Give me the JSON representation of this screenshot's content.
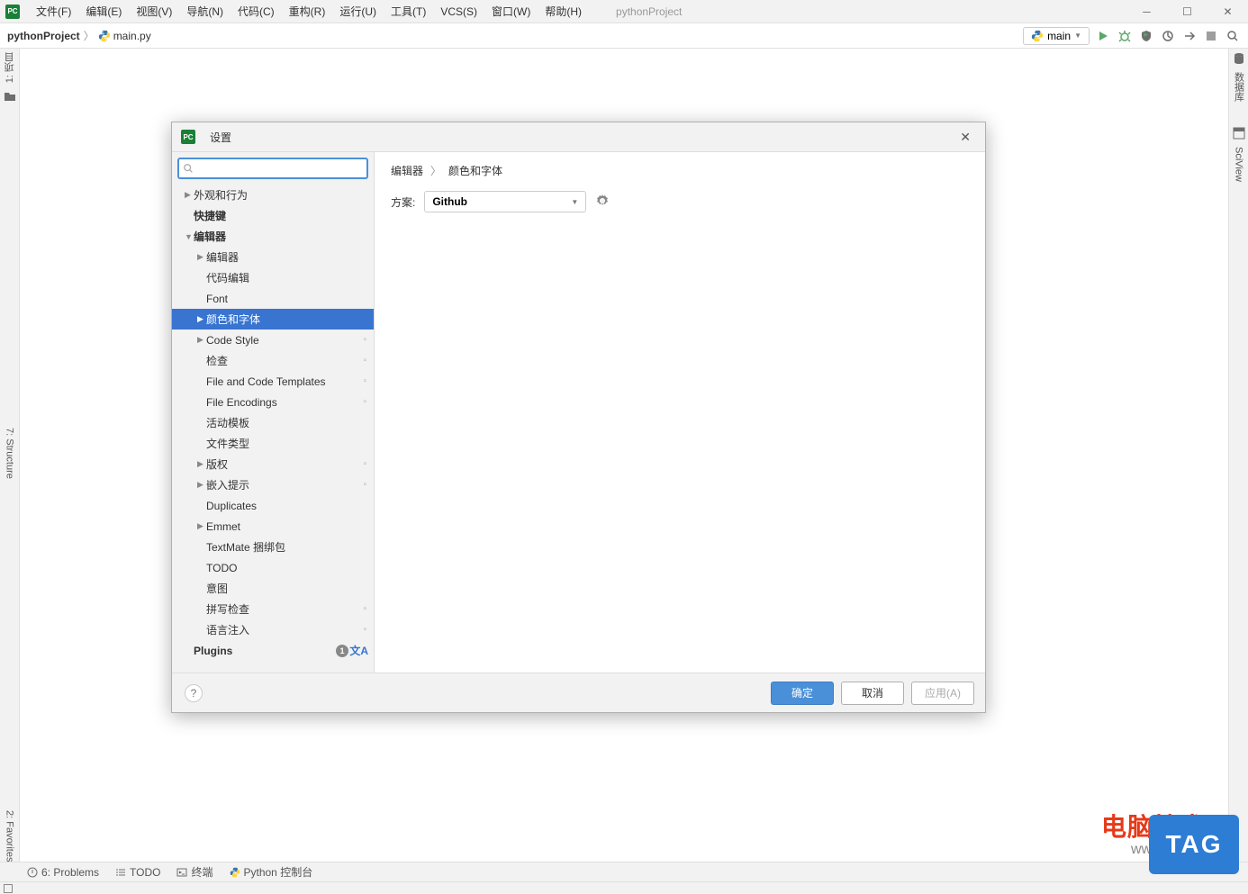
{
  "window": {
    "title": "pythonProject"
  },
  "menu": {
    "file": "文件(F)",
    "edit": "编辑(E)",
    "view": "视图(V)",
    "navigate": "导航(N)",
    "code": "代码(C)",
    "refactor": "重构(R)",
    "run": "运行(U)",
    "tools": "工具(T)",
    "vcs": "VCS(S)",
    "window": "窗口(W)",
    "help": "帮助(H)"
  },
  "breadcrumb": {
    "project": "pythonProject",
    "file": "main.py"
  },
  "toolbar": {
    "run_config": "main"
  },
  "gutters": {
    "left_project": "1: 项目",
    "left_structure": "7: Structure",
    "left_favorites": "2: Favorites",
    "right_db": "数据库",
    "right_sciview": "SciView"
  },
  "bottom": {
    "problems": "6: Problems",
    "todo": "TODO",
    "terminal": "终端",
    "python_console": "Python 控制台"
  },
  "dialog": {
    "title": "设置",
    "search_placeholder": "",
    "crumb1": "编辑器",
    "crumb2": "颜色和字体",
    "scheme_label": "方案:",
    "scheme_value": "Github",
    "ok": "确定",
    "cancel": "取消",
    "apply": "应用(A)",
    "plugins_badge": "1",
    "tree": {
      "appearance": "外观和行为",
      "keymap": "快捷键",
      "editor": "编辑器",
      "editor_sub": "编辑器",
      "code_editing": "代码编辑",
      "font": "Font",
      "color_font": "颜色和字体",
      "code_style": "Code Style",
      "inspections": "检查",
      "file_templates": "File and Code Templates",
      "file_encodings": "File Encodings",
      "live_templates": "活动模板",
      "file_types": "文件类型",
      "copyright": "版权",
      "inlay_hints": "嵌入提示",
      "duplicates": "Duplicates",
      "emmet": "Emmet",
      "textmate": "TextMate 捆绑包",
      "todo": "TODO",
      "intentions": "意图",
      "spelling": "拼写检查",
      "lang_inject": "语言注入",
      "plugins": "Plugins"
    }
  },
  "watermark": {
    "line1": "电脑技术网",
    "line2": "www.tagxp.com",
    "tag": "TAG"
  }
}
